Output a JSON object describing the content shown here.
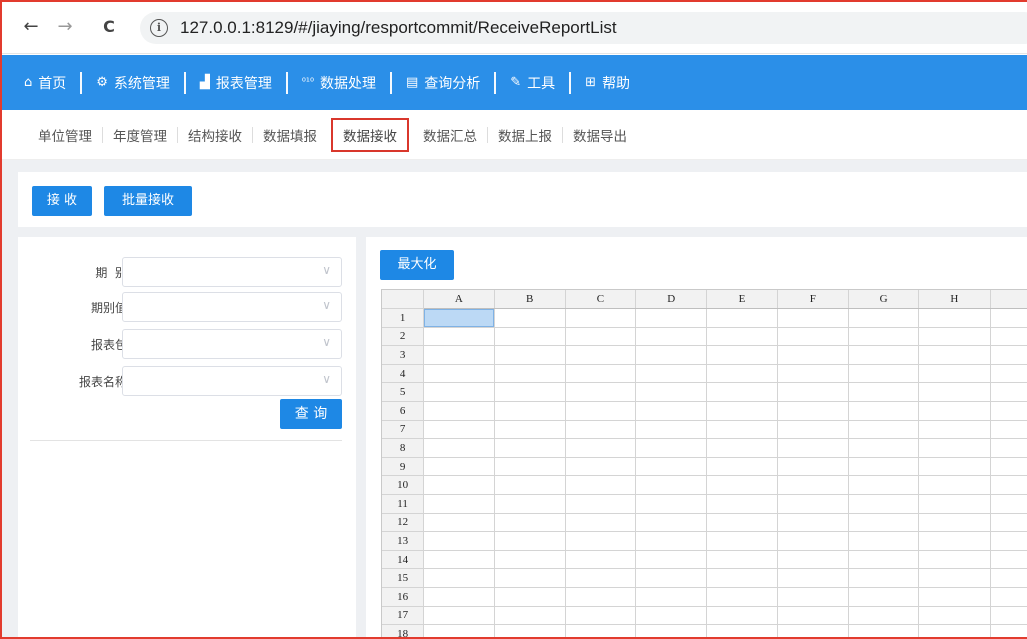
{
  "browser": {
    "back_icon": "←",
    "forward_icon": "→",
    "reload_icon": "C",
    "info_icon": "i",
    "url": "127.0.0.1:8129/#/jiaying/resportcommit/ReceiveReportList"
  },
  "top_menu": [
    {
      "icon": "⌂",
      "icon_name": "home-icon",
      "label": "首页"
    },
    {
      "icon": "⚙",
      "icon_name": "gear-icon",
      "label": "系统管理"
    },
    {
      "icon": "▟",
      "icon_name": "chart-icon",
      "label": "报表管理"
    },
    {
      "icon": "⁰¹⁰",
      "icon_name": "binary-icon",
      "label": "数据处理"
    },
    {
      "icon": "▤",
      "icon_name": "document-search-icon",
      "label": "查询分析"
    },
    {
      "icon": "✎",
      "icon_name": "wrench-icon",
      "label": "工具"
    },
    {
      "icon": "⊞",
      "icon_name": "grid-icon",
      "label": "帮助"
    }
  ],
  "sub_menu": [
    "单位管理",
    "年度管理",
    "结构接收",
    "数据填报",
    "数据接收",
    "数据汇总",
    "数据上报",
    "数据导出"
  ],
  "sub_menu_active": "数据接收",
  "toolbar": {
    "receive_label": "接 收",
    "batch_receive_label": "批量接收"
  },
  "form": {
    "period_label": "期  别:",
    "period_value_label": "期别值:",
    "package_label": "报表包:",
    "report_name_label": "报表名称:",
    "chevron": "∨",
    "query_label": "查 询"
  },
  "sheet": {
    "maximize_label": "最大化",
    "columns": [
      "A",
      "B",
      "C",
      "D",
      "E",
      "F",
      "G",
      "H",
      ""
    ],
    "rows": [
      "1",
      "2",
      "3",
      "4",
      "5",
      "6",
      "7",
      "8",
      "9",
      "10",
      "11",
      "12",
      "13",
      "14",
      "15",
      "16",
      "17",
      "18"
    ]
  },
  "colors": {
    "accent": "#1e88e5",
    "top_bar": "#2b8fe8",
    "highlight_border": "#d9372c"
  }
}
